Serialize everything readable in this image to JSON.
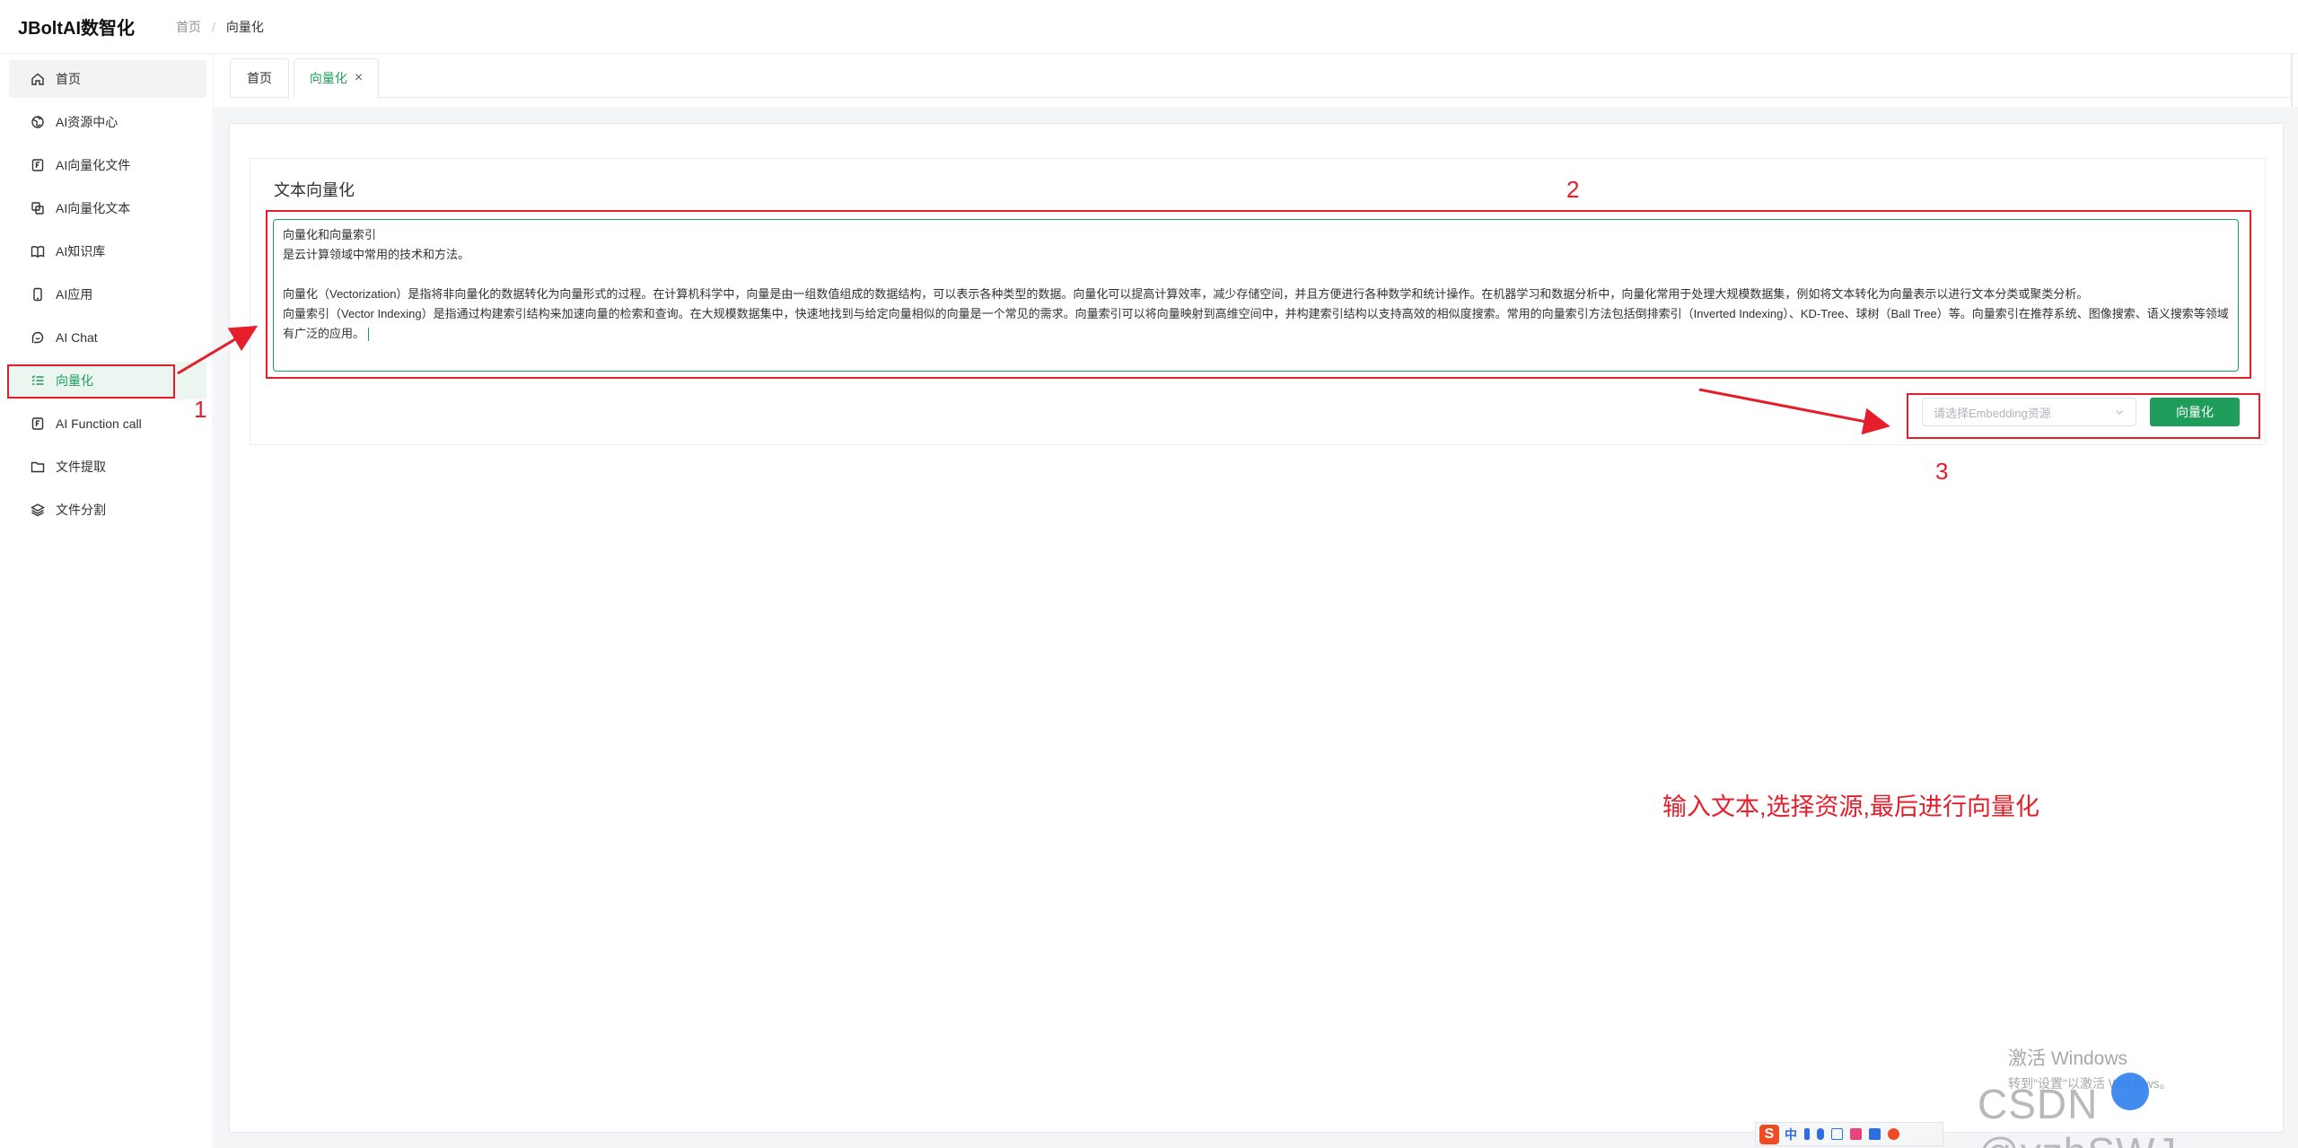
{
  "app": {
    "title": "JBoltAI数智化"
  },
  "breadcrumb": {
    "home": "首页",
    "separator": "/",
    "current": "向量化"
  },
  "sidebar": {
    "items": [
      {
        "label": "首页",
        "icon": "home-icon"
      },
      {
        "label": "AI资源中心",
        "icon": "globe-icon"
      },
      {
        "label": "AI向量化文件",
        "icon": "file-f-icon"
      },
      {
        "label": "AI向量化文本",
        "icon": "copy-icon"
      },
      {
        "label": "AI知识库",
        "icon": "book-icon"
      },
      {
        "label": "AI应用",
        "icon": "phone-icon"
      },
      {
        "label": "AI Chat",
        "icon": "chat-icon"
      },
      {
        "label": "向量化",
        "icon": "list-icon"
      },
      {
        "label": "AI Function call",
        "icon": "function-icon"
      },
      {
        "label": "文件提取",
        "icon": "folder-icon"
      },
      {
        "label": "文件分割",
        "icon": "layers-icon"
      }
    ],
    "active_index": 7
  },
  "tabs": [
    {
      "label": "首页",
      "closable": false
    },
    {
      "label": "向量化",
      "closable": true,
      "close": "×"
    }
  ],
  "vectorize": {
    "card_title": "文本向量化",
    "textarea_lines": [
      "向量化和向量索引",
      "是云计算领域中常用的技术和方法。",
      "",
      "向量化（Vectorization）是指将非向量化的数据转化为向量形式的过程。在计算机科学中，向量是由一组数值组成的数据结构，可以表示各种类型的数据。向量化可以提高计算效率，减少存储空间，并且方便进行各种数学和统计操作。在机器学习和数据分析中，向量化常用于处理大规模数据集，例如将文本转化为向量表示以进行文本分类或聚类分析。",
      "向量索引（Vector Indexing）是指通过构建索引结构来加速向量的检索和查询。在大规模数据集中，快速地找到与给定向量相似的向量是一个常见的需求。向量索引可以将向量映射到高维空间中，并构建索引结构以支持高效的相似度搜索。常用的向量索引方法包括倒排索引（Inverted Indexing）、KD-Tree、球树（Ball Tree）等。向量索引在推荐系统、图像搜索、语义搜索等领域有广泛的应用。"
    ],
    "select_placeholder": "请选择Embedding资源",
    "submit_label": "向量化"
  },
  "annotations": {
    "num1": "1",
    "num2": "2",
    "num3": "3",
    "instruction": "输入文本,选择资源,最后进行向量化",
    "color": "#e41e2b"
  },
  "overlays": {
    "windows_activation_line1": "激活 Windows",
    "windows_activation_line2": "转到\"设置\"以激活 Windows。",
    "watermark": "CSDN @yzhSWJ",
    "ime_logo": "S",
    "ime_lang": "中"
  },
  "colors": {
    "accent": "#1e9e5a",
    "annotation": "#e41e2b"
  }
}
